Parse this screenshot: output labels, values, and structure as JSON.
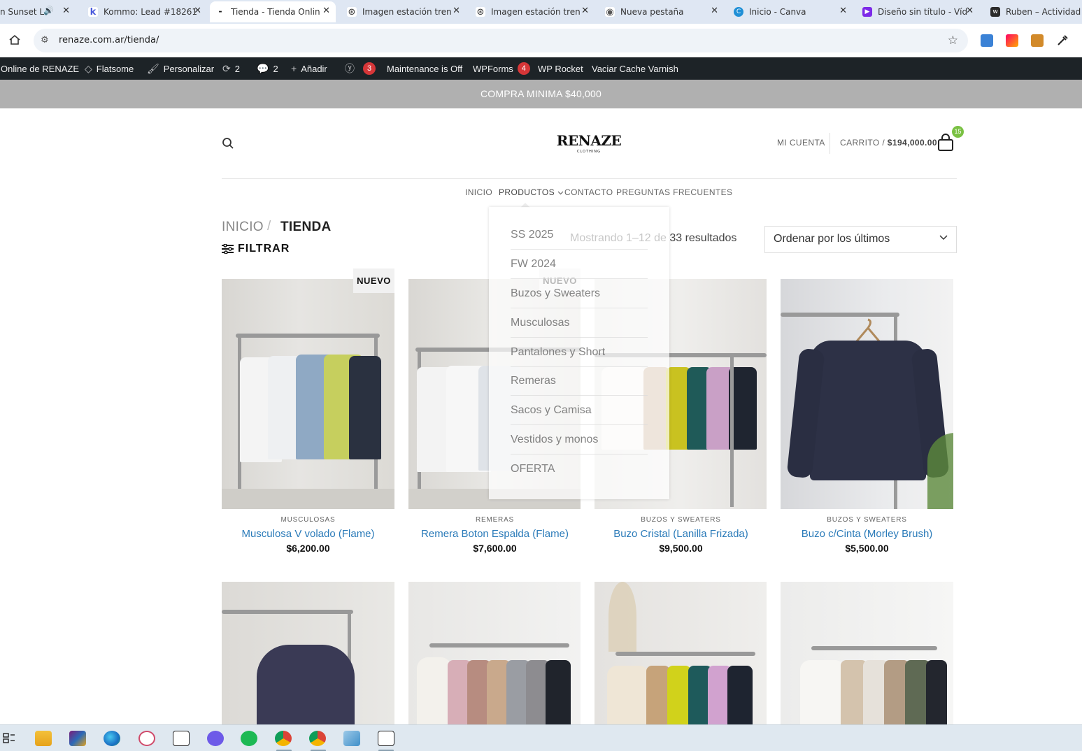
{
  "browser": {
    "tabs": [
      {
        "title": "n Sunset L",
        "favicon_color": "#ffffff",
        "has_audio": true
      },
      {
        "title": "Kommo: Lead #18261",
        "favicon_color": "#4b5bdc"
      },
      {
        "title": "Tienda - Tienda Onlin",
        "favicon_color": "#222222",
        "active": true
      },
      {
        "title": "Imagen estación tren",
        "favicon_color": "#333333"
      },
      {
        "title": "Imagen estación tren",
        "favicon_color": "#333333"
      },
      {
        "title": "Nueva pestaña",
        "favicon_color": "#555555"
      },
      {
        "title": "Inicio - Canva",
        "favicon_color": "#00c4cc"
      },
      {
        "title": "Diseño sin título - Víd",
        "favicon_color": "#7d2ae8"
      },
      {
        "title": "Ruben – Actividad –",
        "favicon_color": "#2b2b2b"
      }
    ],
    "url": "renaze.com.ar/tienda/"
  },
  "wpbar": {
    "site": "Online de RENAZE",
    "theme": "Flatsome",
    "customize": "Personalizar",
    "updates": "2",
    "comments": "2",
    "add_new": "Añadir",
    "yoast_count": "3",
    "maintenance": "Maintenance is Off",
    "wpforms": "WPForms",
    "wpforms_count": "4",
    "wprocket": "WP Rocket",
    "varnish": "Vaciar Cache Varnish"
  },
  "promo": "COMPRA MINIMA $40,000",
  "header": {
    "logo": "RENAZE",
    "logo_sub": "CLOTHING",
    "account": "MI CUENTA",
    "cart_label": "CARRITO /",
    "cart_total": "$194,000.00",
    "cart_count": "15"
  },
  "nav": [
    "INICIO",
    "PRODUCTOS",
    "CONTACTO",
    "PREGUNTAS FRECUENTES"
  ],
  "breadcrumb": {
    "home": "INICIO",
    "sep": "/",
    "current": "TIENDA"
  },
  "filter": "FILTRAR",
  "result_count": "Mostrando 1–12 de 33 resultados",
  "orderby": "Ordenar por los últimos",
  "badge_new": "NUEVO",
  "dropdown": [
    "SS 2025",
    "FW 2024",
    "Buzos y Sweaters",
    "Musculosas",
    "Pantalones y Short",
    "Remeras",
    "Sacos y Camisa",
    "Vestidos y monos",
    "OFERTA"
  ],
  "products": [
    {
      "category": "MUSCULOSAS",
      "name": "Musculosa V volado (Flame)",
      "price": "$6,200.00",
      "new": true
    },
    {
      "category": "REMERAS",
      "name": "Remera Boton Espalda (Flame)",
      "price": "$7,600.00",
      "new": true
    },
    {
      "category": "BUZOS Y SWEATERS",
      "name": "Buzo Cristal (Lanilla Frizada)",
      "price": "$9,500.00",
      "new": false
    },
    {
      "category": "BUZOS Y SWEATERS",
      "name": "Buzo c/Cinta (Morley Brush)",
      "price": "$5,500.00",
      "new": false
    }
  ],
  "colors": {
    "link": "#2b7bb9",
    "cart_badge": "#7ac143",
    "wp_badge": "#d63638",
    "wpbar": "#1d2327",
    "promo": "#b0b0b0"
  }
}
